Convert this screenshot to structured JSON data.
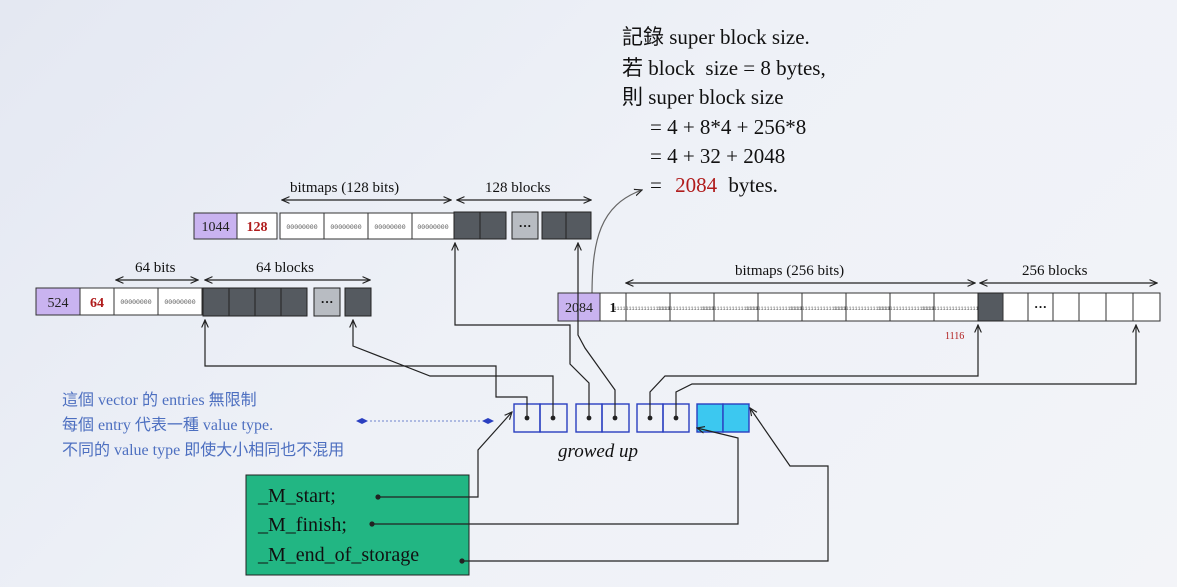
{
  "note": {
    "lines": [
      "記錄 super block size.",
      "若 block  size = 8 bytes,",
      "則 super block size",
      "= 4 + 8*4 + 256*8",
      "= 4 + 32 + 2048"
    ],
    "result_eq": "=",
    "result_value": "2084",
    "result_unit": "bytes."
  },
  "block128": {
    "count_label": "1044",
    "bits_label": "128",
    "bitmaps_caption": "bitmaps (128 bits)",
    "blocks_caption": "128 blocks",
    "bitmap_cell_text": "00000000",
    "ellipsis": "···"
  },
  "block64": {
    "count_label": "524",
    "bits_label": "64",
    "bitmaps_caption": "64 bits",
    "blocks_caption": "64 blocks",
    "bitmap_cell_text": "00000000",
    "ellipsis": "···"
  },
  "block256": {
    "count_label": "2084",
    "bits_label": "1",
    "bitmaps_caption": "bitmaps (256 bits)",
    "blocks_caption": "256 blocks",
    "bitmap_cell_text": "11111111111111111111111",
    "ellipsis": "···",
    "index_label": "1116"
  },
  "vector_note": {
    "lines": [
      "這個 vector 的 entries 無限制",
      "每個 entry 代表一種 value type.",
      "不同的 value type 即使大小相同也不混用"
    ]
  },
  "growed_label": "growed up",
  "members": {
    "start": "_M_start;",
    "finish": "_M_finish;",
    "end": "_M_end_of_storage"
  },
  "colors": {
    "purple_cell": "#c9b3f0",
    "red_text": "#b01c1c",
    "dark_block": "#555a60",
    "vector_blue": "#2a3fc0",
    "note_blue": "#4d6fc0",
    "green_box": "#22b683",
    "cyan": "#3cc8f0"
  }
}
